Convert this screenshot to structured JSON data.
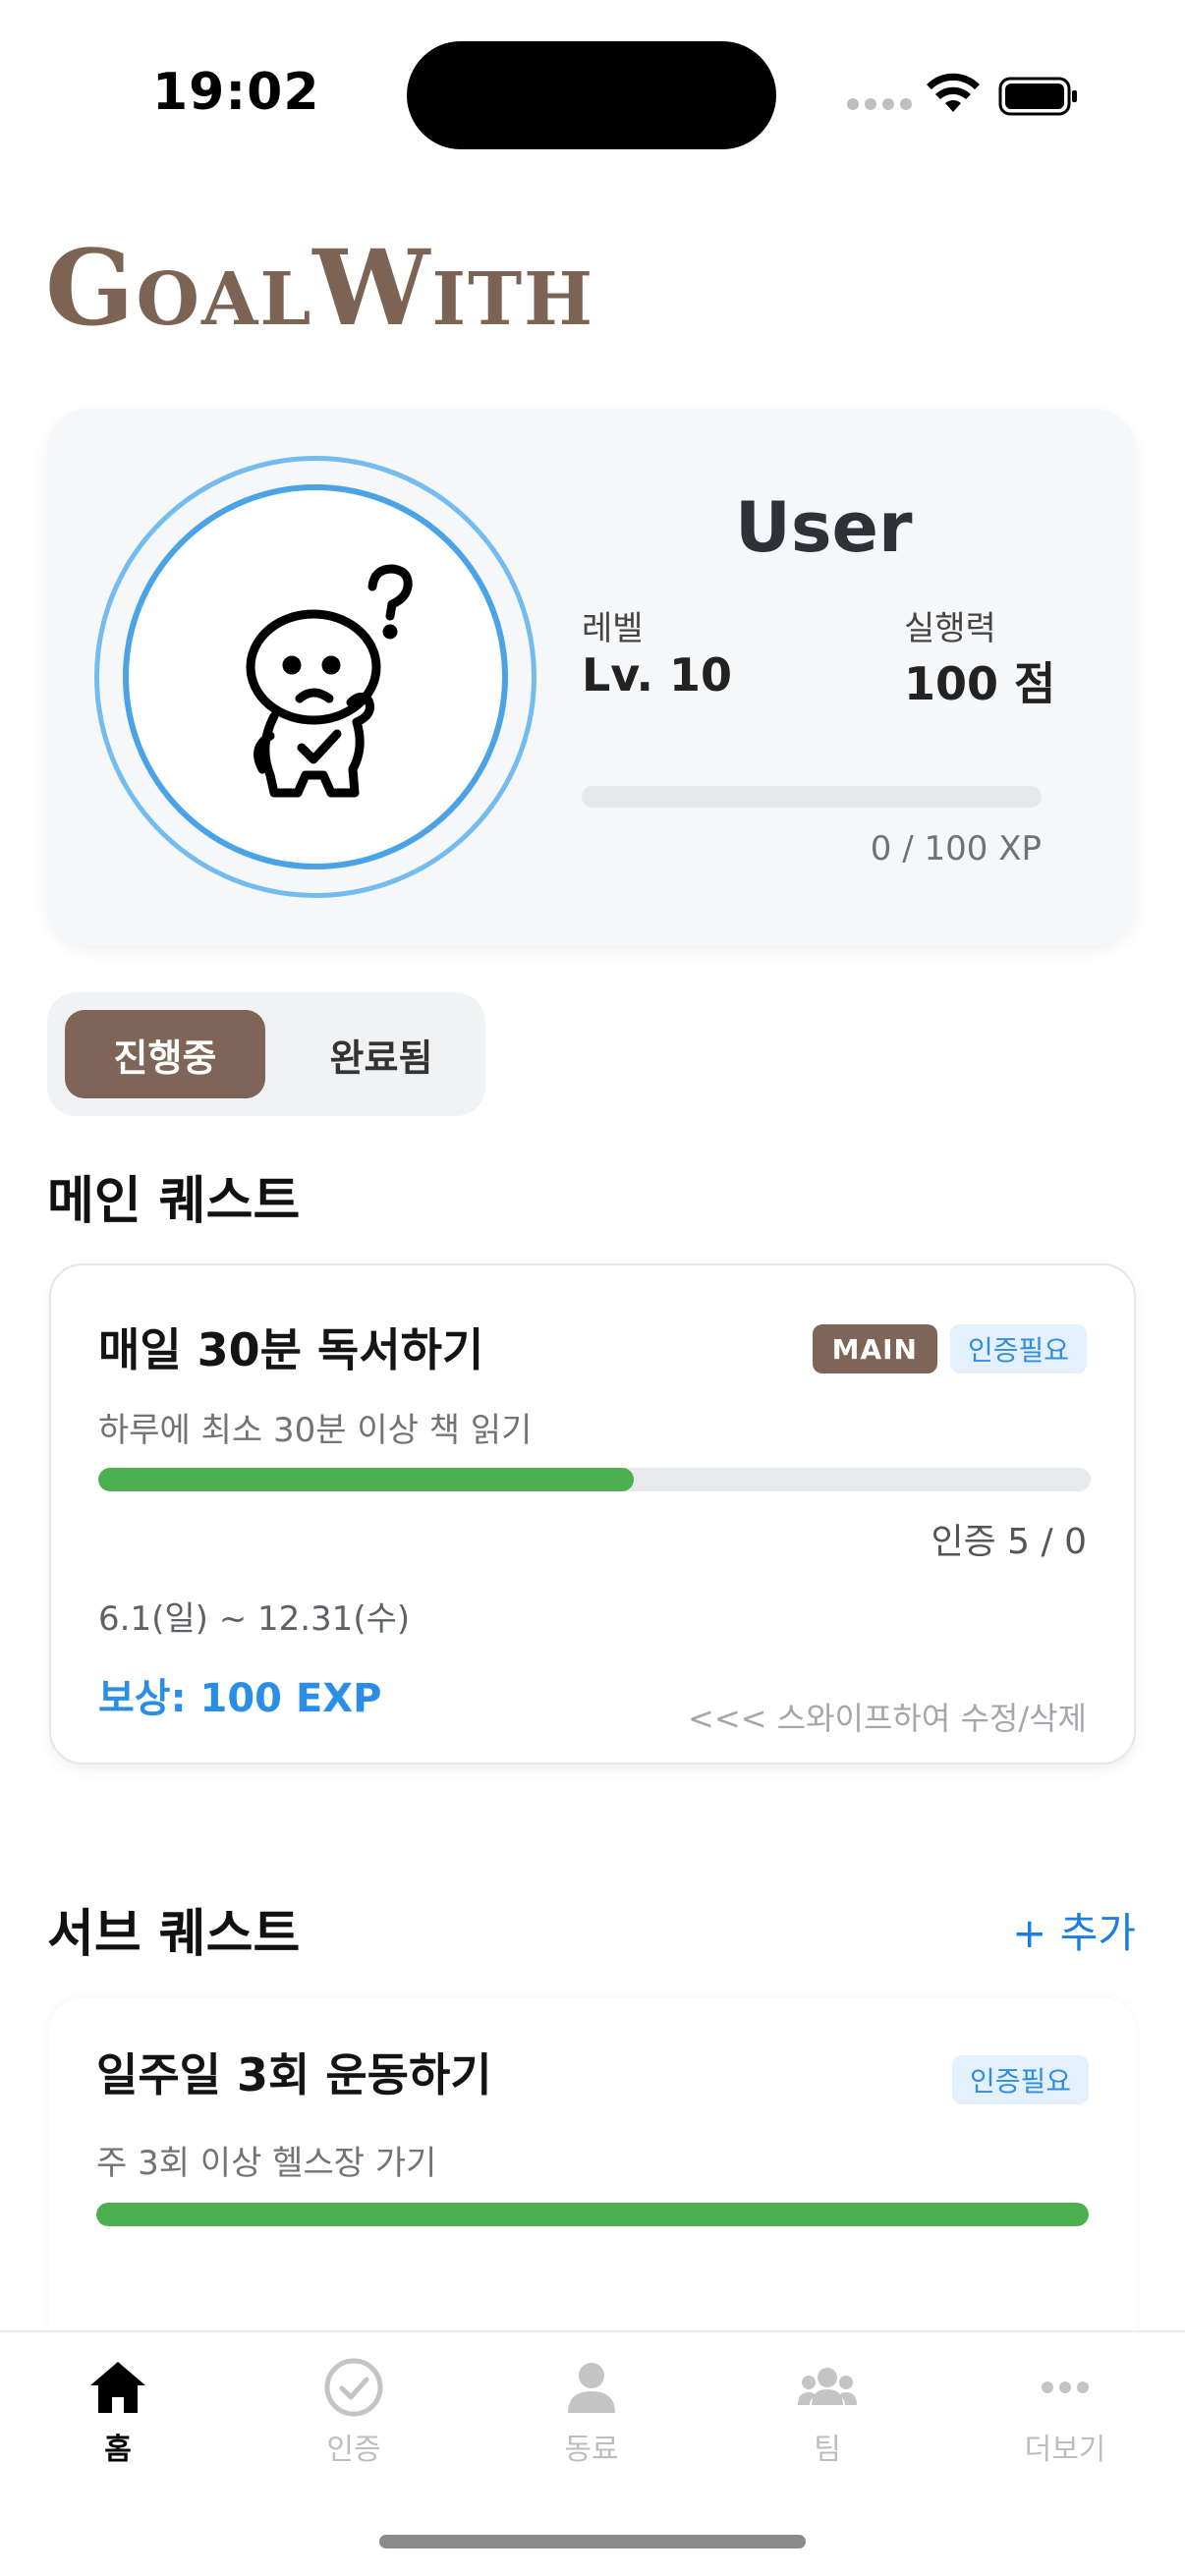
{
  "status_bar": {
    "time": "19:02"
  },
  "app": {
    "logo_text": "GoalWith"
  },
  "profile": {
    "name": "User",
    "level_label": "레벨",
    "level_value": "Lv. 10",
    "skill_label": "실행력",
    "skill_value": "100 점",
    "xp_text": "0 / 100 XP",
    "xp_progress": 0
  },
  "segment": {
    "active": "진행중",
    "inactive": "완료됨"
  },
  "main_section": {
    "title": "메인 퀘스트",
    "quest": {
      "title": "매일 30분 독서하기",
      "badge_main": "MAIN",
      "badge_cert": "인증필요",
      "description": "하루에 최소 30분 이상 책 읽기",
      "progress": 0.54,
      "cert_count": "인증 5 / 0",
      "date_range": "6.1(일) ~ 12.31(수)",
      "reward": "보상: 100 EXP",
      "swipe_hint": "<<< 스와이프하여 수정/삭제"
    }
  },
  "sub_section": {
    "title": "서브 퀘스트",
    "add_label": "+ 추가",
    "quest": {
      "title": "일주일 3회 운동하기",
      "badge_cert": "인증필요",
      "description": "주 3회 이상 헬스장 가기",
      "progress": 1.0
    }
  },
  "tabs": [
    {
      "label": "홈",
      "icon": "home-icon",
      "active": true
    },
    {
      "label": "인증",
      "icon": "check-circle-icon",
      "active": false
    },
    {
      "label": "동료",
      "icon": "person-icon",
      "active": false
    },
    {
      "label": "팀",
      "icon": "group-icon",
      "active": false
    },
    {
      "label": "더보기",
      "icon": "more-icon",
      "active": false
    }
  ],
  "colors": {
    "brand": "#7f6557",
    "accent_blue": "#2b8ee6",
    "progress_green": "#4caf50"
  }
}
